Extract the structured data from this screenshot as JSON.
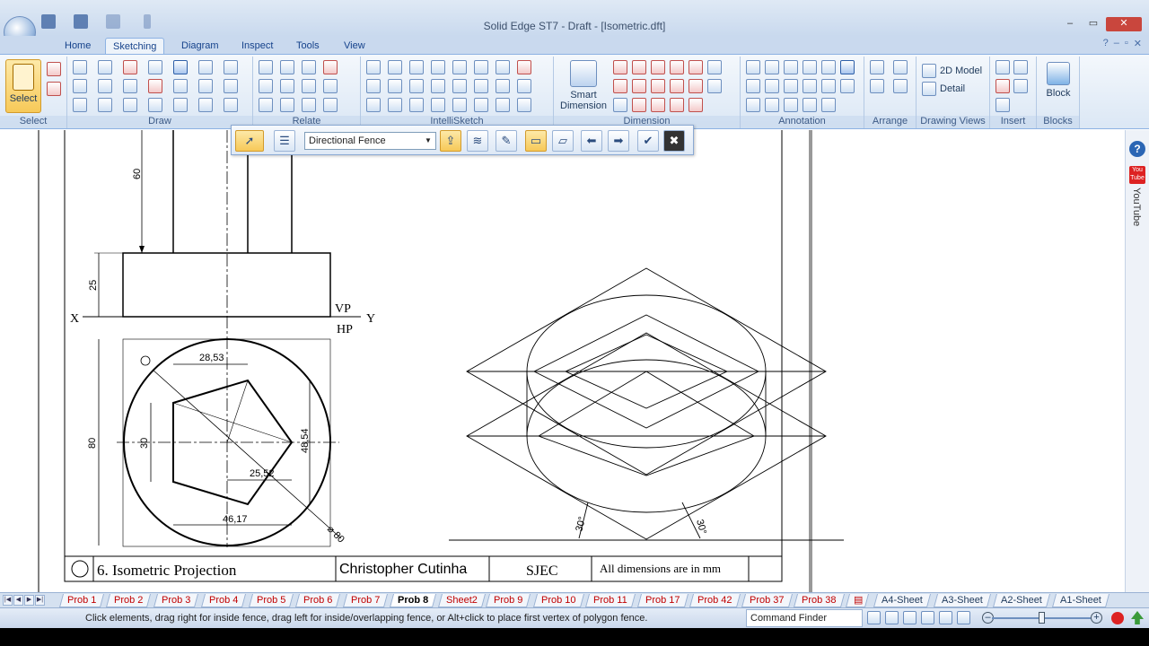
{
  "window": {
    "title": "Solid Edge ST7 - Draft - [Isometric.dft]",
    "controls": [
      "–",
      "▭",
      "✕"
    ],
    "doc_controls": [
      "?",
      "–",
      "▫",
      "✕"
    ]
  },
  "ribbon_tabs": [
    "Home",
    "Sketching",
    "Diagram",
    "Inspect",
    "Tools",
    "View"
  ],
  "ribbon": {
    "select": {
      "label": "Select",
      "group": "Select"
    },
    "groups": [
      "Draw",
      "Relate",
      "IntelliSketch",
      "Dimension",
      "Annotation",
      "Arrange",
      "Drawing Views",
      "Insert",
      "Blocks"
    ],
    "smart_dimension": "Smart\nDimension",
    "model2d": "2D Model",
    "detail": "Detail",
    "block": "Block"
  },
  "fence_toolbar": {
    "mode": "Directional Fence"
  },
  "drawing": {
    "title_block": {
      "title": "6. Isometric Projection",
      "author": "Christopher Cutinha",
      "institute": "SJEC",
      "note": "All dimensions are in mm"
    },
    "labels": {
      "x": "X",
      "y": "Y",
      "vp": "VP",
      "hp": "HP"
    },
    "dims": {
      "d60": "60",
      "d25": "25",
      "d80": "80",
      "d30": "30",
      "d2853": "28,53",
      "d4854": "48,54",
      "d2552": "25,52",
      "d4617": "46,17",
      "dia80": "⌀ 80",
      "ang1": "30°",
      "ang2": "30°"
    }
  },
  "sheet_tabs": [
    "Prob 1",
    "Prob 2",
    "Prob 3",
    "Prob 4",
    "Prob 5",
    "Prob 6",
    "Prob 7",
    "Prob 8",
    "Sheet2",
    "Prob 9",
    "Prob 10",
    "Prob 11",
    "Prob 17",
    "Prob 42",
    "Prob 37",
    "Prob 38",
    "A4-Sheet",
    "A3-Sheet",
    "A2-Sheet",
    "A1-Sheet"
  ],
  "active_sheet": "Prob 8",
  "status": {
    "message": "Click elements, drag right for inside fence, drag left for inside/overlapping fence, or Alt+click to place first vertex of polygon fence.",
    "command_finder": "Command Finder"
  },
  "side": {
    "youtube": "YouTube",
    "help": "?"
  }
}
